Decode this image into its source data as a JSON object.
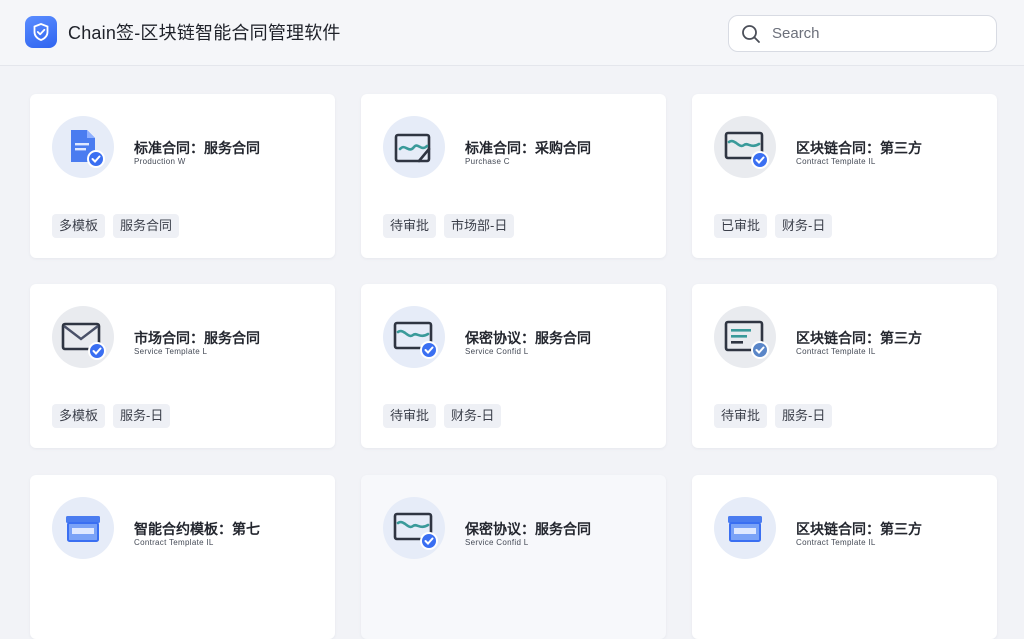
{
  "header": {
    "title": "Chain签-区块链智能合同管理软件",
    "search_placeholder": "Search",
    "logo_icon": "shield-check-icon",
    "brand_color": "#3a6ff2"
  },
  "cards": [
    {
      "icon": "document-verified-icon",
      "title": "标准合同：服务合同",
      "subtitle": "Production W",
      "tags": [
        "多模板",
        "服务合同"
      ]
    },
    {
      "icon": "contract-signature-icon",
      "title": "标准合同：采购合同",
      "subtitle": "Purchase C",
      "tags": [
        "待审批",
        "市场部-日"
      ]
    },
    {
      "icon": "contract-verified-icon",
      "title": "区块链合同：第三方",
      "subtitle": "Contract Template IL",
      "tags": [
        "已审批",
        "财务-日"
      ]
    },
    {
      "icon": "envelope-verified-icon",
      "title": "市场合同：服务合同",
      "subtitle": "Service Template L",
      "tags": [
        "多模板",
        "服务-日"
      ]
    },
    {
      "icon": "contract-verified-icon",
      "title": "保密协议：服务合同",
      "subtitle": "Service Confid L",
      "tags": [
        "待审批",
        "财务-日"
      ]
    },
    {
      "icon": "list-verified-icon",
      "title": "区块链合同：第三方",
      "subtitle": "Contract Template IL",
      "tags": [
        "待审批",
        "服务-日"
      ]
    },
    {
      "icon": "folder-box-icon",
      "title": "智能合约模板：第七",
      "subtitle": "Contract Template IL",
      "tags": []
    },
    {
      "icon": "contract-verified-icon",
      "title": "保密协议：服务合同",
      "subtitle": "Service Confid L",
      "tags": []
    },
    {
      "icon": "folder-box-icon",
      "title": "区块链合同：第三方",
      "subtitle": "Contract Template IL",
      "tags": []
    }
  ]
}
